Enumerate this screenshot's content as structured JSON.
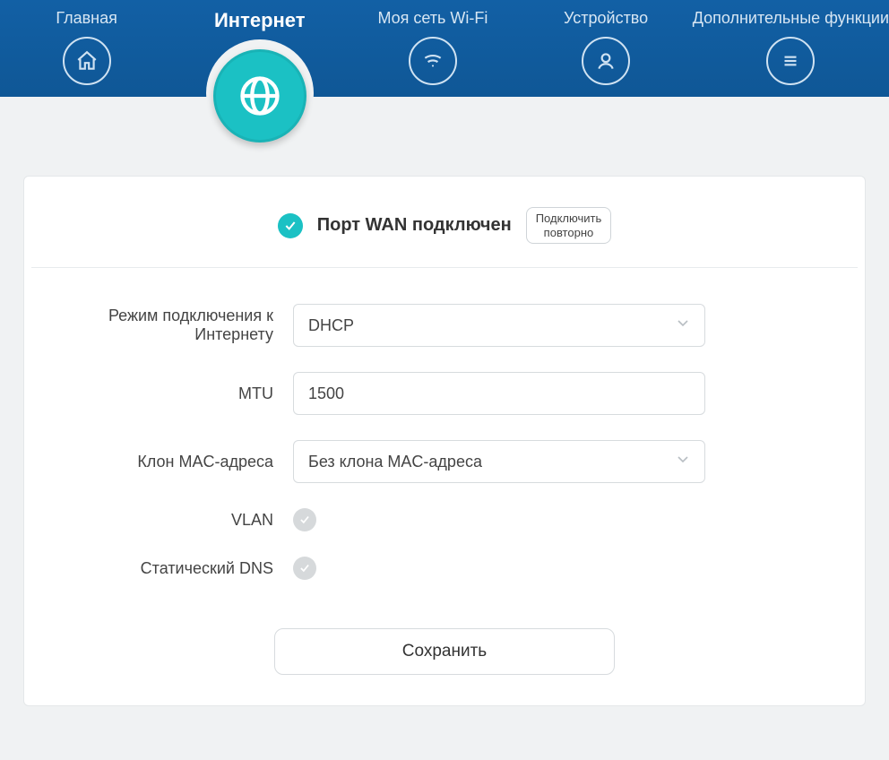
{
  "nav": {
    "items": [
      {
        "label": "Главная",
        "active": false
      },
      {
        "label": "Интернет",
        "active": true
      },
      {
        "label": "Моя сеть Wi-Fi",
        "active": false
      },
      {
        "label": "Устройство",
        "active": false
      },
      {
        "label": "Дополнительные функции",
        "active": false
      }
    ]
  },
  "status": {
    "text": "Порт WAN подключен",
    "reconnect_line1": "Подключить",
    "reconnect_line2": "повторно"
  },
  "form": {
    "connection_mode_label": "Режим подключения к Интернету",
    "connection_mode_value": "DHCP",
    "mtu_label": "MTU",
    "mtu_value": "1500",
    "mac_clone_label": "Клон MAC-адреса",
    "mac_clone_value": "Без клона MAC-адреса",
    "vlan_label": "VLAN",
    "static_dns_label": "Статический DNS"
  },
  "actions": {
    "save": "Сохранить"
  }
}
